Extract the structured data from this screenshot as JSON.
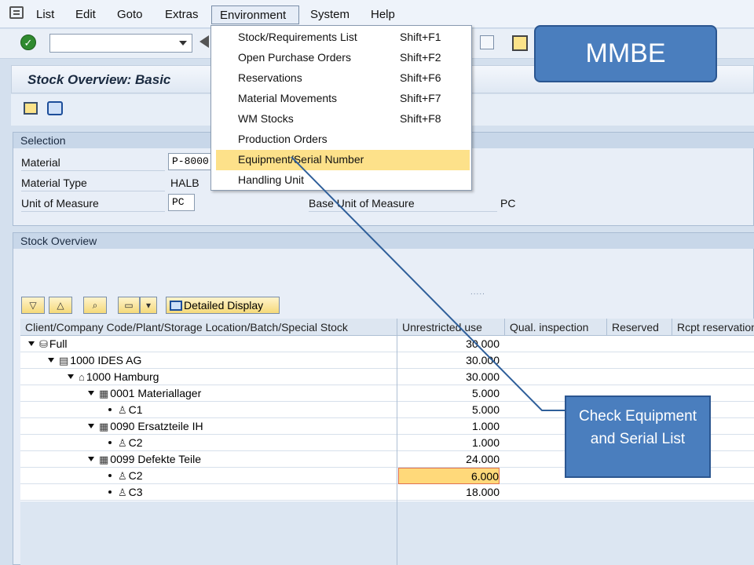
{
  "menubar": {
    "items": [
      "List",
      "Edit",
      "Goto",
      "Extras",
      "Environment",
      "System",
      "Help"
    ]
  },
  "title": "Stock Overview: Basic",
  "selection": {
    "header": "Selection",
    "material_label": "Material",
    "material_value": "P-8000",
    "material_type_label": "Material Type",
    "material_type_value": "HALB",
    "uom_label": "Unit of Measure",
    "uom_value": "PC",
    "base_uom_label": "Base Unit of Measure",
    "base_uom_value": "PC"
  },
  "stock": {
    "header": "Stock Overview",
    "splitter": "....."
  },
  "grid_toolbar": {
    "detail_label": "Detailed Display"
  },
  "grid": {
    "columns": [
      "Client/Company Code/Plant/Storage Location/Batch/Special Stock",
      "Unrestricted use",
      "Qual. inspection",
      "Reserved",
      "Rcpt reservation"
    ],
    "rows": [
      {
        "label": "Full",
        "value": "30.000"
      },
      {
        "label": "1000 IDES AG",
        "value": "30.000"
      },
      {
        "label": "1000 Hamburg",
        "value": "30.000"
      },
      {
        "label": "0001 Materiallager",
        "value": "5.000"
      },
      {
        "label": "C1",
        "value": "5.000"
      },
      {
        "label": "0090 Ersatzteile IH",
        "value": "1.000"
      },
      {
        "label": "C2",
        "value": "1.000"
      },
      {
        "label": "0099 Defekte Teile",
        "value": "24.000"
      },
      {
        "label": "C2",
        "value": "6.000"
      },
      {
        "label": "C3",
        "value": "18.000"
      }
    ]
  },
  "dropdown": {
    "items": [
      {
        "label": "Stock/Requirements List",
        "shortcut": "Shift+F1"
      },
      {
        "label": "Open Purchase Orders",
        "shortcut": "Shift+F2"
      },
      {
        "label": "Reservations",
        "shortcut": "Shift+F6"
      },
      {
        "label": "Material Movements",
        "shortcut": "Shift+F7"
      },
      {
        "label": "WM Stocks",
        "shortcut": "Shift+F8"
      },
      {
        "label": "Production Orders",
        "shortcut": ""
      },
      {
        "label": "Equipment/Serial Number",
        "shortcut": ""
      },
      {
        "label": "Handling Unit",
        "shortcut": ""
      }
    ]
  },
  "callouts": {
    "mmbe": "MMBE",
    "check": "Check Equipment and Serial List"
  },
  "colors": {
    "callout": "#4a7ebe",
    "highlight": "#fde18a"
  }
}
